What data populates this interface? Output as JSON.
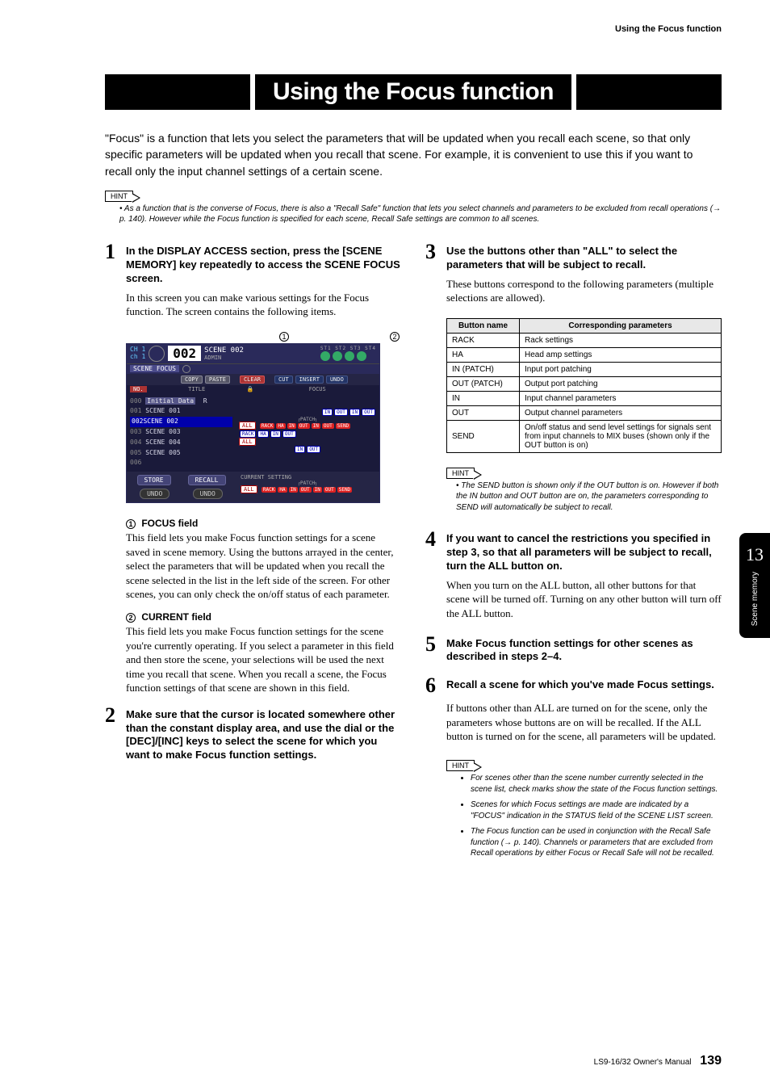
{
  "running_head": "Using the Focus function",
  "title": "Using the Focus function",
  "intro": "\"Focus\" is a function that lets you select the parameters that will be updated when you recall each scene, so that only specific parameters will be updated when you recall that scene. For example, it is convenient to use this if you want to recall only the input channel settings of a certain scene.",
  "hint_label": "HINT",
  "hint1": "As a function that is the converse of Focus, there is also a \"Recall Safe\" function that lets you select channels and parameters to be excluded from recall operations (→ p. 140). However while the Focus function is specified for each scene, Recall Safe settings are common to all scenes.",
  "left": {
    "step1_head": "In the DISPLAY ACCESS section, press the [SCENE MEMORY] key repeatedly to access the SCENE FOCUS screen.",
    "step1_body": "In this screen you can make various settings for the Focus function. The screen contains the following items.",
    "callout1": "1",
    "callout2": "2",
    "screen": {
      "ch": "CH 1\nch 1",
      "num": "002",
      "scene": "SCENE 002",
      "admin": "ADMIN",
      "st": "ST1 ST2 ST3 ST4",
      "scene_focus": "SCENE FOCUS",
      "copy": "COPY",
      "paste": "PASTE",
      "clear": "CLEAR",
      "cut": "CUT",
      "insert": "INSERT",
      "undo": "UNDO",
      "no": "NO.",
      "title_h": "TITLE",
      "focus_h": "FOCUS",
      "rows": [
        {
          "idx": "000",
          "name": "Initial Data",
          "r": "R"
        },
        {
          "idx": "001",
          "name": "SCENE 001"
        },
        {
          "idx": "002",
          "name": "SCENE 002",
          "sel": true
        },
        {
          "idx": "003",
          "name": "SCENE 003"
        },
        {
          "idx": "004",
          "name": "SCENE 004"
        },
        {
          "idx": "005",
          "name": "SCENE 005"
        },
        {
          "idx": "006",
          "name": ""
        }
      ],
      "all": "ALL",
      "patch": "PATCH",
      "tags": [
        "RACK",
        "HA",
        "IN",
        "OUT",
        "IN",
        "OUT",
        "SEND"
      ],
      "tags2": [
        "RACK",
        "HA",
        "IN",
        "OUT"
      ],
      "tags3": [
        "IN",
        "OUT",
        "IN",
        "OUT"
      ],
      "tags4": [
        "IN",
        "OUT"
      ],
      "store": "STORE",
      "recall": "RECALL",
      "undo2": "UNDO",
      "current": "CURRENT SETTING"
    },
    "f1_head": "FOCUS field",
    "f1_body": "This field lets you make Focus function settings for a scene saved in scene memory. Using the buttons arrayed in the center, select the parameters that will be updated when you recall the scene selected in the list in the left side of the screen. For other scenes, you can only check the on/off status of each parameter.",
    "f2_head": "CURRENT field",
    "f2_body": "This field lets you make Focus function settings for the scene you're currently operating. If you select a parameter in this field and then store the scene, your selections will be used the next time you recall that scene. When you recall a scene, the Focus function settings of that scene are shown in this field.",
    "step2_head": "Make sure that the cursor is located somewhere other than the constant display area, and use the dial or the [DEC]/[INC] keys to select the scene for which you want to make Focus function settings."
  },
  "right": {
    "step3_head": "Use the buttons other than \"ALL\" to select the parameters that will be subject to recall.",
    "step3_body": "These buttons correspond to the following parameters (multiple selections are allowed).",
    "table": {
      "h1": "Button name",
      "h2": "Corresponding parameters",
      "rows": [
        [
          "RACK",
          "Rack settings"
        ],
        [
          "HA",
          "Head amp settings"
        ],
        [
          "IN (PATCH)",
          "Input port patching"
        ],
        [
          "OUT (PATCH)",
          "Output port patching"
        ],
        [
          "IN",
          "Input channel parameters"
        ],
        [
          "OUT",
          "Output channel parameters"
        ],
        [
          "SEND",
          "On/off status and send level settings for signals sent from input channels to MIX buses (shown only if the OUT button is on)"
        ]
      ]
    },
    "hint2": "The SEND button is shown only if the OUT button is on. However if both the IN button and OUT button are on, the parameters corresponding to SEND will automatically be subject to recall.",
    "step4_head": "If you want to cancel the restrictions you specified in step 3, so that all parameters will be subject to recall, turn the ALL button on.",
    "step4_body": "When you turn on the ALL button, all other buttons for that scene will be turned off. Turning on any other button will turn off the ALL button.",
    "step5_head": "Make Focus function settings for other scenes as described in steps 2–4.",
    "step6_head": "Recall a scene for which you've made Focus settings.",
    "step6_body": "If buttons other than ALL are turned on for the scene, only the parameters whose buttons are on will be recalled. If the ALL button is turned on for the scene, all parameters will be updated.",
    "hints3": [
      "For scenes other than the scene number currently selected in the scene list, check marks show the state of the Focus function settings.",
      "Scenes for which Focus settings are made are indicated by a \"FOCUS\" indication in the STATUS field of the SCENE LIST screen.",
      "The Focus function can be used in conjunction with the Recall Safe function (→ p. 140). Channels or parameters that are excluded from Recall operations by either Focus or Recall Safe will not be recalled."
    ]
  },
  "side": {
    "chapter": "13",
    "label": "Scene memory"
  },
  "footer": {
    "manual": "LS9-16/32  Owner's Manual",
    "page": "139"
  }
}
